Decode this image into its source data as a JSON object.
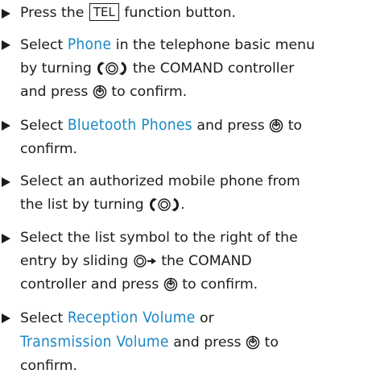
{
  "steps": [
    {
      "pre": "Press the",
      "key": "TEL",
      "post": "function button."
    },
    {
      "pre": "Select",
      "display": "Phone",
      "mid": "in the telephone basic menu",
      "mid2": "by turning",
      "mid3": "the COMAND controller",
      "mid4": "and press",
      "post": "to confirm."
    },
    {
      "pre": "Select",
      "display": "Bluetooth Phones",
      "mid": "and press",
      "post": "to",
      "post2": "confirm."
    },
    {
      "line1": "Select an authorized mobile phone from",
      "line2": "the list by turning"
    },
    {
      "line1": "Select the list symbol to the right of the",
      "line2_pre": "entry by sliding",
      "line2_post": "the COMAND",
      "line3_pre": "controller and press",
      "line3_post": "to confirm."
    },
    {
      "pre": "Select",
      "display1": "Reception Volume",
      "mid": "or",
      "display2": "Transmission Volume",
      "mid2": "and press",
      "post": "to",
      "post2": "confirm."
    }
  ],
  "icons": {
    "rotate": "rotate-controller-icon",
    "press": "press-controller-icon",
    "slide": "slide-right-controller-icon"
  },
  "colors": {
    "text": "#1c1c1c",
    "display_text": "#1a87c3"
  }
}
